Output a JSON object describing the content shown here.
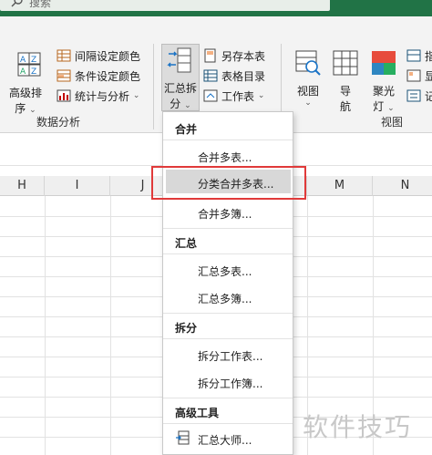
{
  "search": {
    "placeholder_text": "搜索"
  },
  "ribbon": {
    "sort_button": {
      "line1": "高级排",
      "line2": "序"
    },
    "analysis_group": {
      "items": [
        "间隔设定颜色",
        "条件设定颜色",
        "统计与分析"
      ],
      "label": "数据分析"
    },
    "summary_split_button": {
      "line1": "汇总拆",
      "line2": "分"
    },
    "export_group": {
      "items": [
        "另存本表",
        "表格目录",
        "工作表"
      ]
    },
    "view_button": "视图",
    "nav_button": {
      "line1": "导",
      "line2": "航"
    },
    "spotlight_button": {
      "line1": "聚光",
      "line2": "灯"
    },
    "right_items": [
      "指",
      "显",
      "记"
    ],
    "view_group_label": "视图"
  },
  "grid": {
    "columns": [
      "H",
      "I",
      "J",
      "M",
      "N"
    ]
  },
  "menu": {
    "sections": [
      {
        "title": "合并",
        "items": [
          "合并多表...",
          "分类合并多表...",
          "合并多簿..."
        ]
      },
      {
        "title": "汇总",
        "items": [
          "汇总多表...",
          "汇总多簿..."
        ]
      },
      {
        "title": "拆分",
        "items": [
          "拆分工作表...",
          "拆分工作簿..."
        ]
      },
      {
        "title": "高级工具",
        "items": [
          "汇总大师..."
        ]
      }
    ],
    "highlighted_item": "分类合并多表..."
  },
  "watermark": "软件技巧",
  "colors": {
    "title_bar": "#217346",
    "highlight_box": "#e03a3a"
  }
}
